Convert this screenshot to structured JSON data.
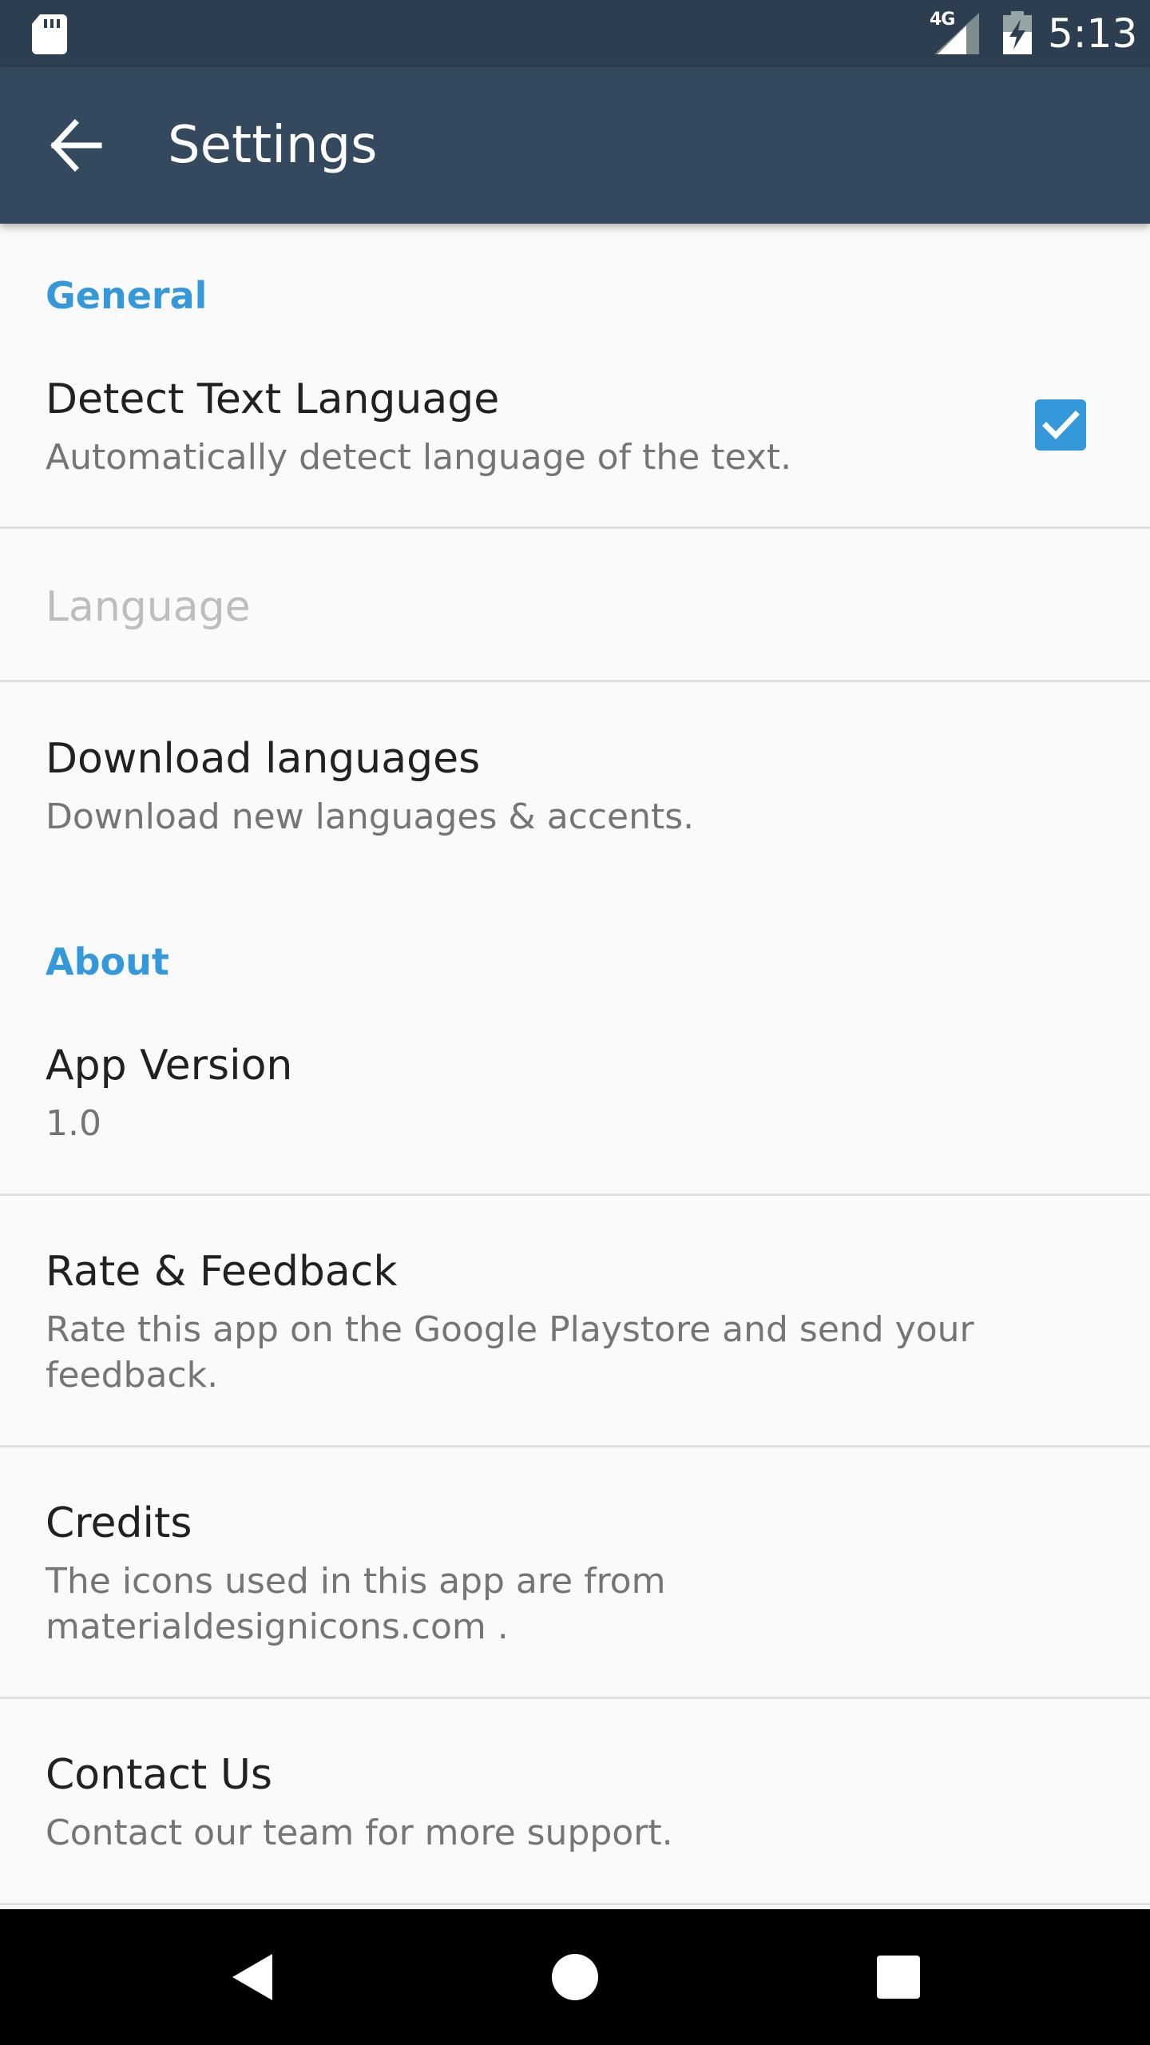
{
  "status_bar": {
    "time": "5:13",
    "network_type": "4G",
    "icons": [
      "sd-card-icon",
      "signal-icon",
      "battery-charging-icon"
    ]
  },
  "toolbar": {
    "title": "Settings",
    "back_icon": "arrow-left-icon"
  },
  "sections": {
    "general": {
      "header": "General",
      "detect_text_language": {
        "title": "Detect Text Language",
        "summary": "Automatically detect language of the text.",
        "checked": true
      },
      "language": {
        "title": "Language",
        "enabled": false
      },
      "download_languages": {
        "title": "Download languages",
        "summary": "Download new languages & accents."
      }
    },
    "about": {
      "header": "About",
      "app_version": {
        "title": "App Version",
        "summary": "1.0"
      },
      "rate_feedback": {
        "title": "Rate & Feedback",
        "summary": "Rate this app on the Google Playstore and send your feedback."
      },
      "credits": {
        "title": "Credits",
        "summary": "The icons used in this app are from materialdesignicons.com ."
      },
      "contact_us": {
        "title": "Contact Us",
        "summary": "Contact our team for more support."
      }
    }
  },
  "nav_bar": {
    "buttons": [
      "back-triangle-icon",
      "home-circle-icon",
      "recents-square-icon"
    ]
  },
  "colors": {
    "status_bar": "#2c3e50",
    "toolbar": "#34495e",
    "accent": "#3498db",
    "background": "#fafafa",
    "nav_bar": "#000000"
  }
}
